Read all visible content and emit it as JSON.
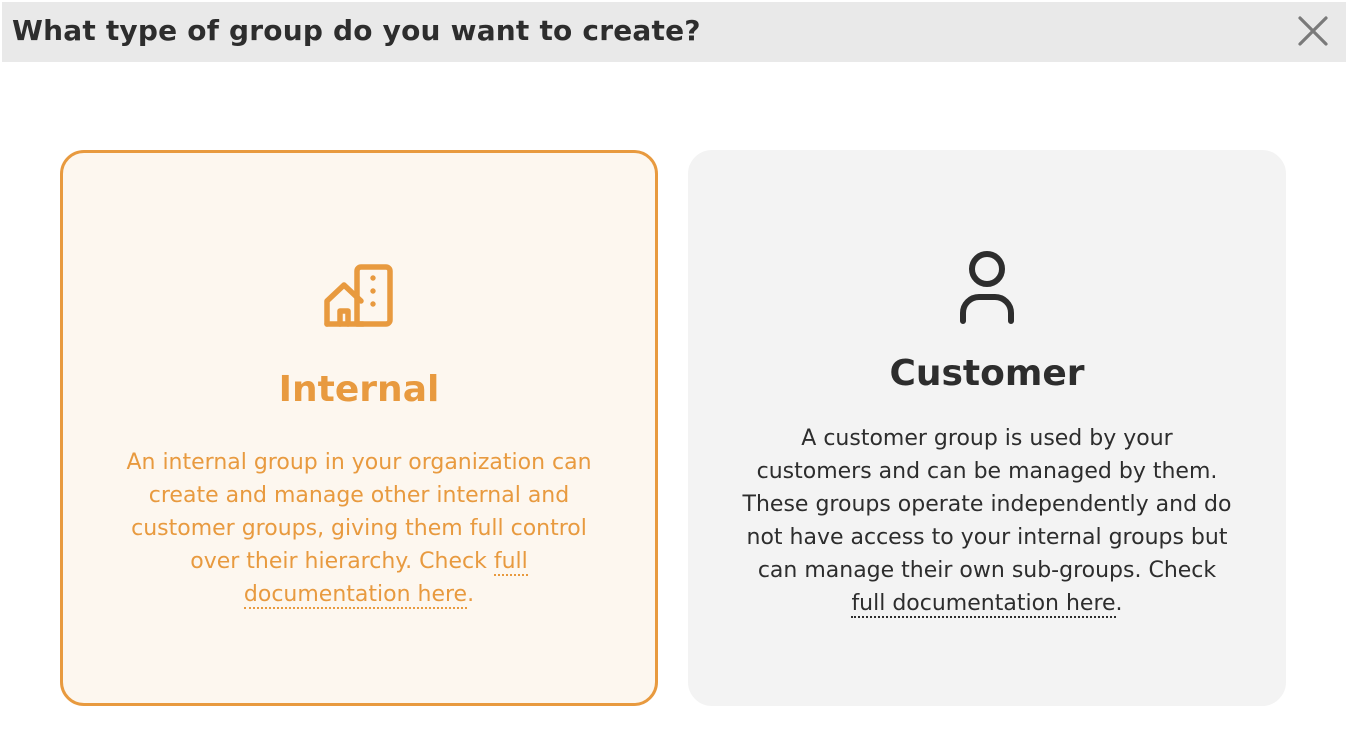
{
  "dialog": {
    "title": "What type of group do you want to create?",
    "close_icon": "close-icon"
  },
  "options": {
    "internal": {
      "icon": "building-icon",
      "title": "Internal",
      "description": "An internal group in your organization can create and manage other internal and customer groups, giving them full control over their hierarchy. Check ",
      "link_text": "full documentation here",
      "suffix": ".",
      "selected": true,
      "accent_color": "#e89a3f"
    },
    "customer": {
      "icon": "user-icon",
      "title": "Customer",
      "description": "A customer group is used by your customers and can be managed by them. These groups operate independently and do not have access to your internal groups but can manage their own sub-groups. Check ",
      "link_text": "full documentation here",
      "suffix": ".",
      "selected": false
    }
  }
}
